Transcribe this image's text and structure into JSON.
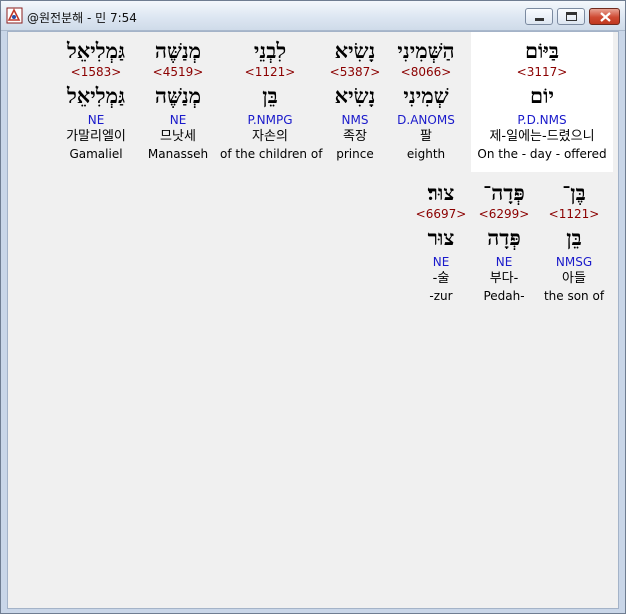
{
  "window": {
    "title": "@원전분해 - 민 7:54",
    "buttons": {
      "minimize": "minimize",
      "maximize": "maximize",
      "close": "close"
    }
  },
  "row1": [
    {
      "hebrew": "בַּיּוֹם",
      "strong": "<3117>",
      "lemma": "יוֹם",
      "parse": "P.D.NMS",
      "korean": "제-일에는-드렸으니",
      "english": "On the - day - offered"
    },
    {
      "hebrew": "הַשְּׁמִינִי",
      "strong": "<8066>",
      "lemma": "שְׁמִינִי",
      "parse": "D.ANOMS",
      "korean": "팔",
      "english": "eighth"
    },
    {
      "hebrew": "נָשִׂיא",
      "strong": "<5387>",
      "lemma": "נָשִׂיא",
      "parse": "NMS",
      "korean": "족장",
      "english": "prince"
    },
    {
      "hebrew": "לִבְנֵי",
      "strong": "<1121>",
      "lemma": "בֵּן",
      "parse": "P.NMPG",
      "korean": "자손의",
      "english": "of the children of"
    },
    {
      "hebrew": "מְנַשֶּׁה",
      "strong": "<4519>",
      "lemma": "מְנַשֶּׁה",
      "parse": "NE",
      "korean": "므낫세",
      "english": "Manasseh"
    },
    {
      "hebrew": "גַּמְלִיאֵל",
      "strong": "<1583>",
      "lemma": "גַּמְלִיאֵל",
      "parse": "NE",
      "korean": "가말리엘이",
      "english": "Gamaliel"
    }
  ],
  "row2": [
    {
      "hebrew": "בֶּן־",
      "strong": "<1121>",
      "lemma": "בֵּן",
      "parse": "NMSG",
      "korean": "아들",
      "english": "the son of"
    },
    {
      "hebrew": "פְּדָה־",
      "strong": "<6299>",
      "lemma": "פְּדָה",
      "parse": "NE",
      "korean": "부다-",
      "english": "Pedah-"
    },
    {
      "hebrew": "צוּר׃",
      "strong": "<6697>",
      "lemma": "צוּר",
      "parse": "NE",
      "korean": "-술",
      "english": "-zur"
    }
  ]
}
